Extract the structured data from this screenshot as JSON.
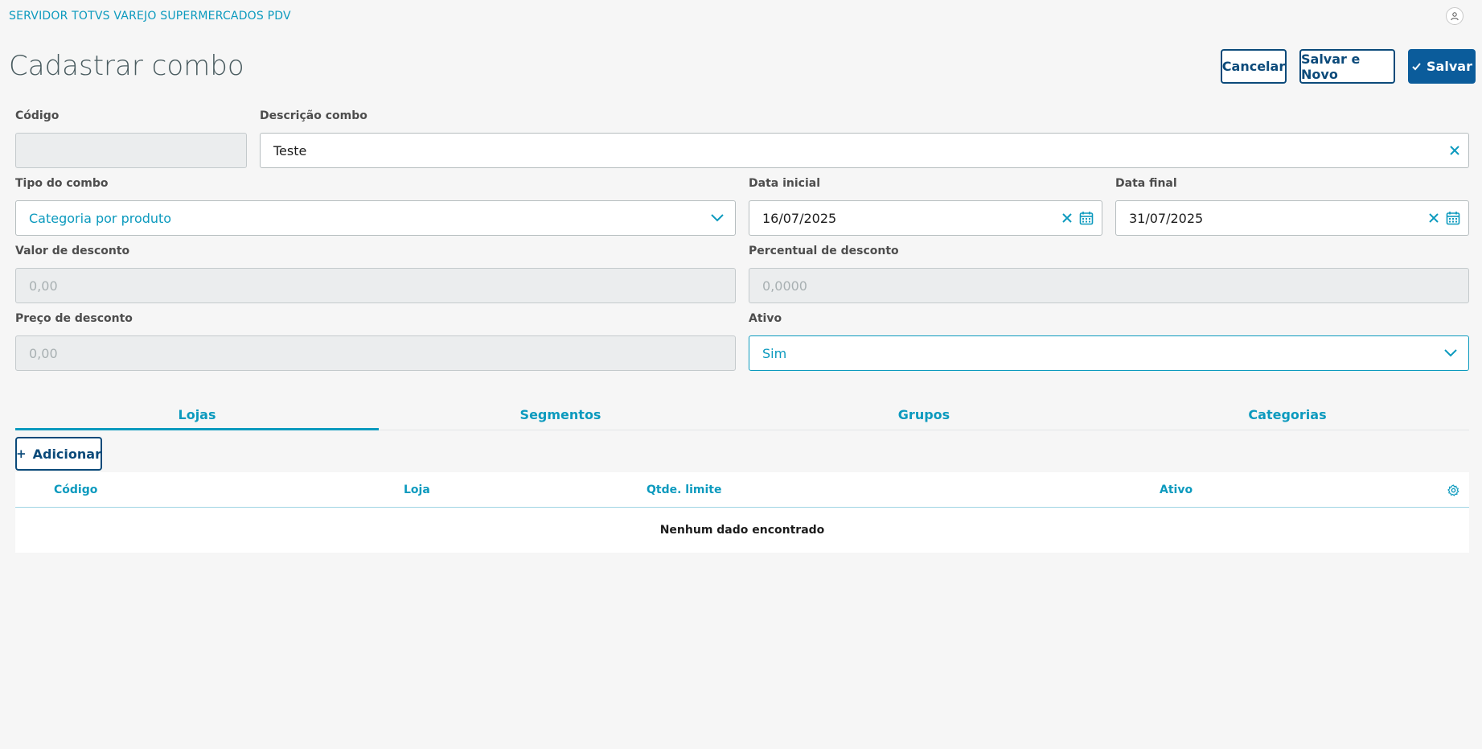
{
  "header": {
    "app_title": "SERVIDOR TOTVS VAREJO SUPERMERCADOS PDV",
    "avatar_icon": "user-icon"
  },
  "page": {
    "title": "Cadastrar combo"
  },
  "actions": {
    "cancel_label": "Cancelar",
    "save_new_label": "Salvar e Novo",
    "save_label": "Salvar",
    "save_icon": "check-icon"
  },
  "form": {
    "codigo": {
      "label": "Código",
      "value": ""
    },
    "descricao": {
      "label": "Descrição combo",
      "value": "Teste"
    },
    "tipo": {
      "label": "Tipo do combo",
      "value": "Categoria por produto"
    },
    "data_inicial": {
      "label": "Data inicial",
      "value": "16/07/2025"
    },
    "data_final": {
      "label": "Data final",
      "value": "31/07/2025"
    },
    "valor_desconto": {
      "label": "Valor de desconto",
      "placeholder": "0,00"
    },
    "percentual_desconto": {
      "label": "Percentual de desconto",
      "placeholder": "0,0000"
    },
    "preco_desconto": {
      "label": "Preço de desconto",
      "placeholder": "0,00"
    },
    "ativo": {
      "label": "Ativo",
      "value": "Sim"
    }
  },
  "tabs": [
    {
      "label": "Lojas",
      "active": true
    },
    {
      "label": "Segmentos",
      "active": false
    },
    {
      "label": "Grupos",
      "active": false
    },
    {
      "label": "Categorias",
      "active": false
    }
  ],
  "table": {
    "add_label": "Adicionar",
    "columns": [
      "Código",
      "Loja",
      "Qtde. limite",
      "Ativo"
    ],
    "empty_text": "Nenhum dado encontrado",
    "settings_icon": "gear-icon"
  },
  "colors": {
    "accent": "#0c9abe",
    "primary": "#0b5c9b",
    "outline": "#0b4a7a",
    "background": "#f6f6f6"
  }
}
